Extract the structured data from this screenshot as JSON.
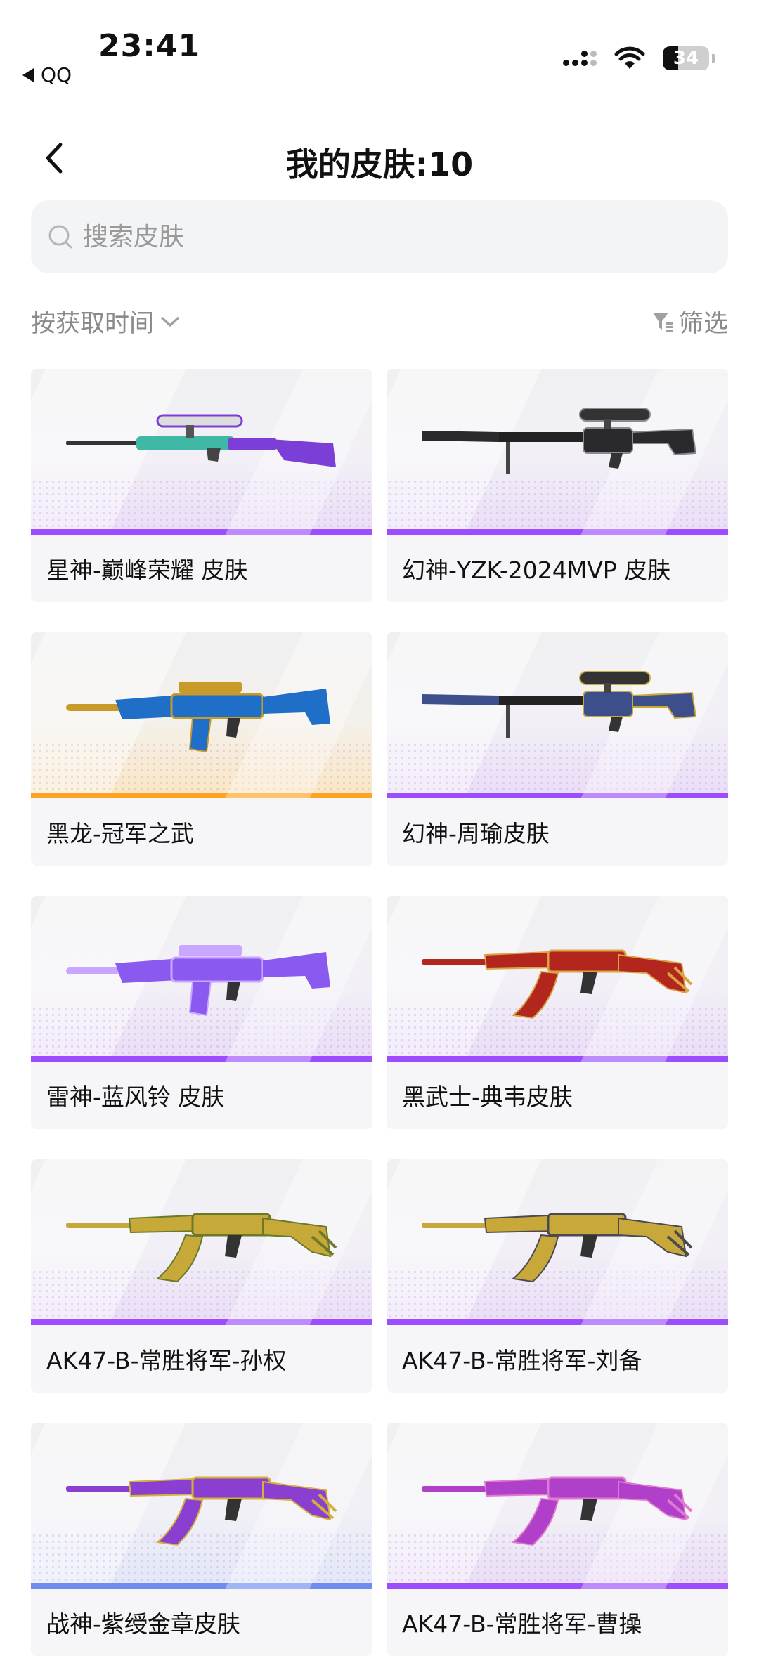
{
  "status": {
    "time": "23:41",
    "back_app": "QQ",
    "battery": "34",
    "battery_fraction": 0.34
  },
  "header": {
    "title": "我的皮肤:10"
  },
  "search": {
    "placeholder": "搜索皮肤"
  },
  "toolbar": {
    "sort_label": "按获取时间",
    "filter_label": "筛选"
  },
  "colors": {
    "purple": "#9b4dff",
    "gold": "#ffa321",
    "blue": "#6f8df0"
  },
  "skins": [
    {
      "name": "星神-巅峰荣耀 皮肤",
      "rarity": "purple",
      "weapon": "sniper",
      "c1": "#7b3fd8",
      "c2": "#3fb9a6"
    },
    {
      "name": "幻神-YZK-2024MVP 皮肤",
      "rarity": "purple",
      "weapon": "heavy-sniper",
      "c1": "#2a2a2e",
      "c2": "#8a8a90"
    },
    {
      "name": "黑龙-冠军之武",
      "rarity": "gold",
      "weapon": "rifle",
      "c1": "#1f6ec7",
      "c2": "#c89a2a"
    },
    {
      "name": "幻神-周瑜皮肤",
      "rarity": "purple",
      "weapon": "heavy-sniper",
      "c1": "#3c4f8a",
      "c2": "#c9a83a"
    },
    {
      "name": "雷神-蓝风铃 皮肤",
      "rarity": "purple",
      "weapon": "rifle",
      "c1": "#8a5af0",
      "c2": "#c9a6ff"
    },
    {
      "name": "黑武士-典韦皮肤",
      "rarity": "purple",
      "weapon": "ak",
      "c1": "#b3261e",
      "c2": "#d9a441"
    },
    {
      "name": "AK47-B-常胜将军-孙权",
      "rarity": "purple",
      "weapon": "ak",
      "c1": "#c7a93a",
      "c2": "#6a7a2a"
    },
    {
      "name": "AK47-B-常胜将军-刘备",
      "rarity": "purple",
      "weapon": "ak",
      "c1": "#c9a83a",
      "c2": "#4a4a55"
    },
    {
      "name": "战神-紫绶金章皮肤",
      "rarity": "blue",
      "weapon": "ak",
      "c1": "#8a3fd0",
      "c2": "#d4b23a"
    },
    {
      "name": "AK47-B-常胜将军-曹操",
      "rarity": "purple",
      "weapon": "ak",
      "c1": "#b03fc9",
      "c2": "#e07ad0"
    }
  ]
}
